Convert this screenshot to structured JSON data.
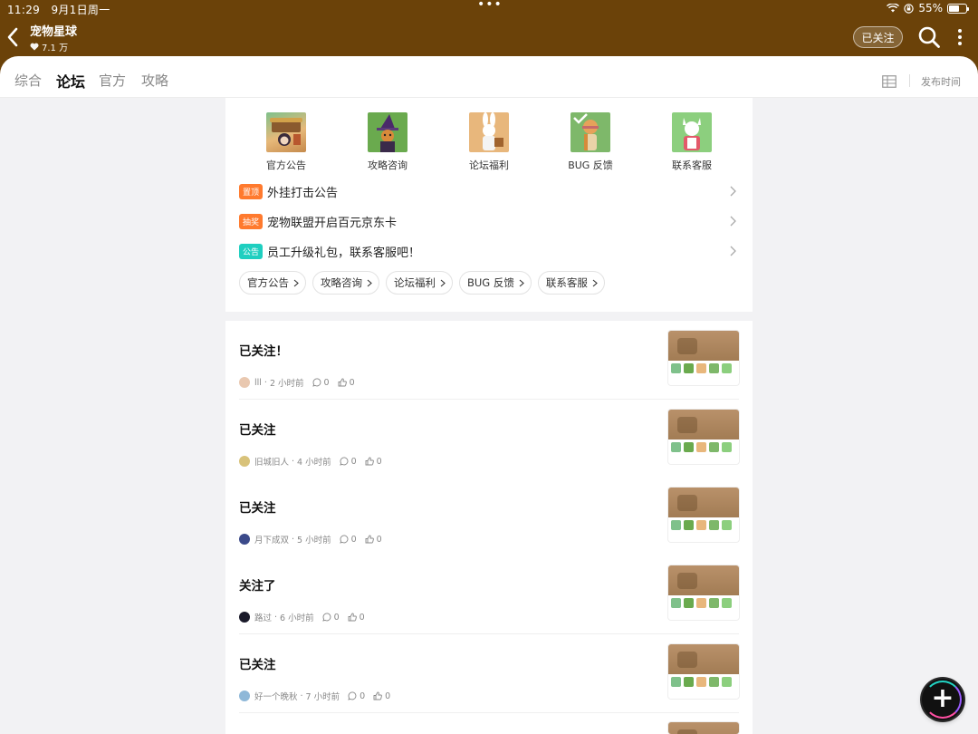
{
  "status": {
    "time": "11:29",
    "date": "9月1日周一",
    "battery": "55%"
  },
  "header": {
    "title": "宠物星球",
    "fans": "7.1 万",
    "follow_label": "已关注"
  },
  "tabs": [
    {
      "label": "综合"
    },
    {
      "label": "论坛"
    },
    {
      "label": "官方"
    },
    {
      "label": "攻略"
    }
  ],
  "sort_label": "发布时间",
  "categories": [
    {
      "label": "官方公告"
    },
    {
      "label": "攻略咨询"
    },
    {
      "label": "论坛福利"
    },
    {
      "label": "BUG 反馈"
    },
    {
      "label": "联系客服"
    }
  ],
  "notices": [
    {
      "badge": "置顶",
      "text": "外挂打击公告",
      "color": "#ff7a2e"
    },
    {
      "badge": "抽奖",
      "text": "宠物联盟开启百元京东卡",
      "color": "#ff7a2e"
    },
    {
      "badge": "公告",
      "text": "员工升级礼包，联系客服吧！",
      "color": "#1fcfc0"
    }
  ],
  "chips": [
    {
      "label": "官方公告"
    },
    {
      "label": "攻略咨询"
    },
    {
      "label": "论坛福利"
    },
    {
      "label": "BUG 反馈"
    },
    {
      "label": "联系客服"
    }
  ],
  "posts": [
    {
      "title": "已关注！",
      "author": "lll",
      "time": "2 小时前",
      "comments": "0",
      "likes": "0"
    },
    {
      "title": "已关注",
      "author": "旧城旧人",
      "time": "4 小时前",
      "comments": "0",
      "likes": "0"
    },
    {
      "title": "已关注",
      "author": "月下成双",
      "time": "5 小时前",
      "comments": "0",
      "likes": "0"
    },
    {
      "title": "关注了",
      "author": "路过",
      "time": "6 小时前",
      "comments": "0",
      "likes": "0"
    },
    {
      "title": "已关注",
      "author": "好一个晚秋",
      "time": "7 小时前",
      "comments": "0",
      "likes": "0"
    }
  ],
  "colors": {
    "header_bg": "#6b4209",
    "accent": "#21d5c5"
  }
}
